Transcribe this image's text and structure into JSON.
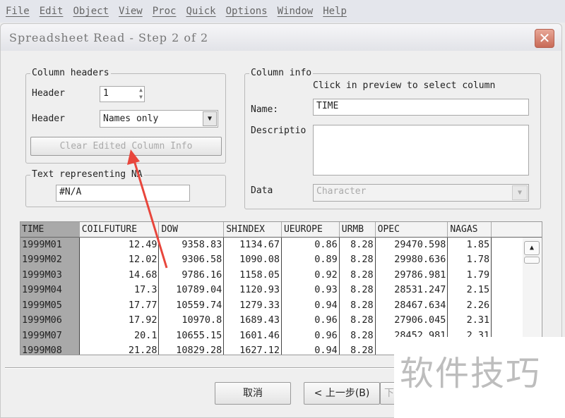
{
  "menu": [
    "File",
    "Edit",
    "Object",
    "View",
    "Proc",
    "Quick",
    "Options",
    "Window",
    "Help"
  ],
  "dialog": {
    "title": "Spreadsheet Read - Step 2 of 2",
    "close_icon": "close-icon"
  },
  "column_headers": {
    "legend": "Column headers",
    "header_label": "Header",
    "header_value": "1",
    "header2_label": "Header",
    "header2_value": "Names only",
    "clear_button": "Clear Edited Column Info"
  },
  "na": {
    "legend": "Text representing NA",
    "value": "#N/A"
  },
  "column_info": {
    "legend": "Column info",
    "hint": "Click in preview to select column",
    "name_label": "Name:",
    "name_value": "TIME",
    "desc_label": "Descriptio",
    "desc_value": "",
    "data_label": "Data",
    "data_value": "Character"
  },
  "table": {
    "columns": [
      "TIME",
      "COILFUTURE",
      "DOW",
      "SHINDEX",
      "UEUROPE",
      "URMB",
      "OPEC",
      "NAGAS",
      ""
    ],
    "rows": [
      [
        "1999M01",
        "12.49",
        "9358.83",
        "1134.67",
        "0.86",
        "8.28",
        "29470.598",
        "1.85"
      ],
      [
        "1999M02",
        "12.02",
        "9306.58",
        "1090.08",
        "0.89",
        "8.28",
        "29980.636",
        "1.78"
      ],
      [
        "1999M03",
        "14.68",
        "9786.16",
        "1158.05",
        "0.92",
        "8.28",
        "29786.981",
        "1.79"
      ],
      [
        "1999M04",
        "17.3",
        "10789.04",
        "1120.93",
        "0.93",
        "8.28",
        "28531.247",
        "2.15"
      ],
      [
        "1999M05",
        "17.77",
        "10559.74",
        "1279.33",
        "0.94",
        "8.28",
        "28467.634",
        "2.26"
      ],
      [
        "1999M06",
        "17.92",
        "10970.8",
        "1689.43",
        "0.96",
        "8.28",
        "27906.045",
        "2.31"
      ],
      [
        "1999M07",
        "20.1",
        "10655.15",
        "1601.46",
        "0.96",
        "8.28",
        "28452.981",
        "2.31"
      ],
      [
        "1999M08",
        "21.28",
        "10829.28",
        "1627.12",
        "0.94",
        "8.28",
        "",
        ""
      ]
    ]
  },
  "buttons": {
    "cancel": "取消",
    "back": "< 上一步(B)",
    "next": "下"
  },
  "watermark": "软件技巧",
  "colors": {
    "annotation_arrow": "#e8463c"
  }
}
